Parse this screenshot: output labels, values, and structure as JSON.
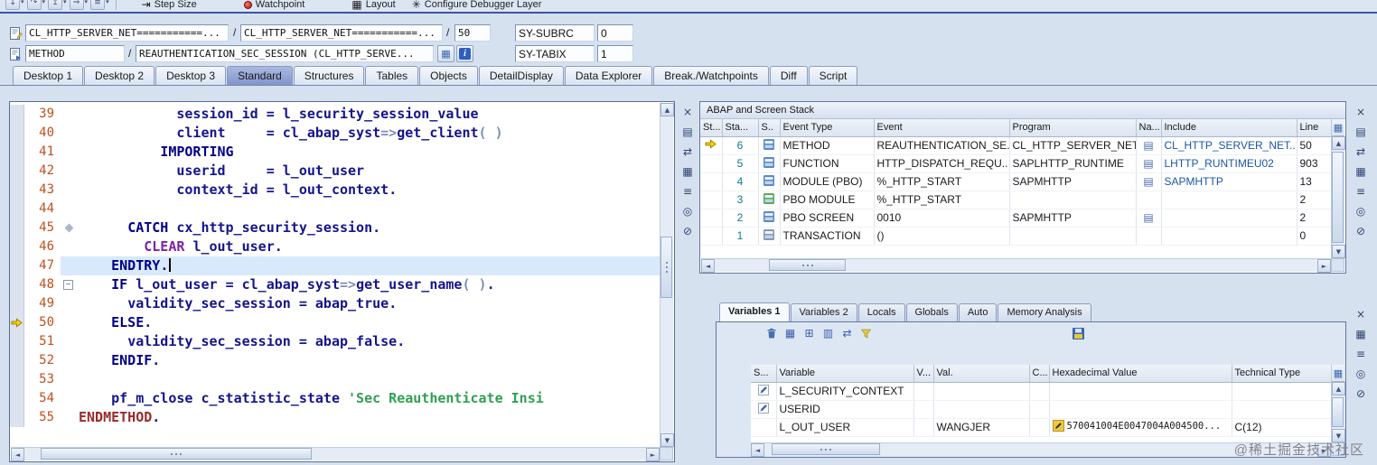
{
  "window": {
    "watermark": "@稀土掘金技术社区"
  },
  "toolbar": {
    "left_icons": [
      {
        "name": "step-into-icon"
      },
      {
        "name": "step-over-icon"
      },
      {
        "name": "step-return-icon"
      },
      {
        "name": "step-continue-icon"
      },
      {
        "name": "step-menu-icon"
      }
    ],
    "buttons": [
      {
        "name": "step-size-button",
        "icon": "step-size-icon",
        "label": "Step Size"
      },
      {
        "name": "watchpoint-button",
        "icon": "watchpoint-icon",
        "label": "Watchpoint"
      },
      {
        "name": "layout-button",
        "icon": "layout-icon",
        "label": "Layout"
      },
      {
        "name": "configure-debugger-layer-button",
        "icon": "configure-icon",
        "label": "Configure Debugger Layer"
      }
    ]
  },
  "header": {
    "slash": "/",
    "row1_icon": "source-page-icon",
    "row2_icon": "method-page-icon",
    "display_button_icon": "display-icon",
    "info_button_icon": "info-icon",
    "main_program": "CL_HTTP_SERVER_NET===========...",
    "source_code_of": "CL_HTTP_SERVER_NET===========...",
    "line_number": "50",
    "sy_subrc_label": "SY-SUBRC",
    "sy_subrc_value": "0",
    "event_type": "METHOD",
    "event_name": "REAUTHENTICATION_SEC_SESSION (CL_HTTP_SERVE...",
    "sy_tabix_label": "SY-TABIX",
    "sy_tabix_value": "1"
  },
  "desktop_tabs": {
    "active": "Standard",
    "items": [
      "Desktop 1",
      "Desktop 2",
      "Desktop 3",
      "Standard",
      "Structures",
      "Tables",
      "Objects",
      "DetailDisplay",
      "Data Explorer",
      "Break./Watchpoints",
      "Diff",
      "Script"
    ]
  },
  "editor": {
    "current_line": 47,
    "execution_line": 50,
    "lines": [
      {
        "n": 39,
        "t": [
          [
            "pl",
            "            "
          ],
          [
            "id",
            "session_id"
          ],
          [
            "pl",
            " "
          ],
          [
            "op",
            "="
          ],
          [
            "pl",
            " "
          ],
          [
            "id",
            "l_security_session_value"
          ]
        ]
      },
      {
        "n": 40,
        "t": [
          [
            "pl",
            "            "
          ],
          [
            "id",
            "client"
          ],
          [
            "pl",
            "     "
          ],
          [
            "op",
            "="
          ],
          [
            "pl",
            " "
          ],
          [
            "id",
            "cl_abap_syst"
          ],
          [
            "arr",
            "=>"
          ],
          [
            "id",
            "get_client"
          ],
          [
            "brk",
            "( )"
          ]
        ]
      },
      {
        "n": 41,
        "t": [
          [
            "pl",
            "          "
          ],
          [
            "kw",
            "IMPORTING"
          ]
        ]
      },
      {
        "n": 42,
        "t": [
          [
            "pl",
            "            "
          ],
          [
            "id",
            "userid"
          ],
          [
            "pl",
            "     "
          ],
          [
            "op",
            "="
          ],
          [
            "pl",
            " "
          ],
          [
            "id",
            "l_out_user"
          ]
        ]
      },
      {
        "n": 43,
        "t": [
          [
            "pl",
            "            "
          ],
          [
            "id",
            "context_id"
          ],
          [
            "pl",
            " "
          ],
          [
            "op",
            "="
          ],
          [
            "pl",
            " "
          ],
          [
            "id",
            "l_out_context"
          ],
          [
            "op",
            "."
          ]
        ]
      },
      {
        "n": 44,
        "t": []
      },
      {
        "n": 45,
        "fold": "diamond",
        "t": [
          [
            "pl",
            "      "
          ],
          [
            "kw",
            "CATCH"
          ],
          [
            "pl",
            " "
          ],
          [
            "id",
            "cx_http_security_session"
          ],
          [
            "op",
            "."
          ]
        ]
      },
      {
        "n": 46,
        "t": [
          [
            "pl",
            "        "
          ],
          [
            "kw2",
            "CLEAR"
          ],
          [
            "pl",
            " "
          ],
          [
            "id",
            "l_out_user"
          ],
          [
            "op",
            "."
          ]
        ]
      },
      {
        "n": 47,
        "caret": true,
        "t": [
          [
            "pl",
            "    "
          ],
          [
            "kw",
            "ENDTRY"
          ],
          [
            "op",
            "."
          ]
        ]
      },
      {
        "n": 48,
        "fold": "minus",
        "t": [
          [
            "pl",
            "    "
          ],
          [
            "kw",
            "IF"
          ],
          [
            "pl",
            " "
          ],
          [
            "id",
            "l_out_user"
          ],
          [
            "pl",
            " "
          ],
          [
            "op",
            "="
          ],
          [
            "pl",
            " "
          ],
          [
            "id",
            "cl_abap_syst"
          ],
          [
            "arr",
            "=>"
          ],
          [
            "id",
            "get_user_name"
          ],
          [
            "brk",
            "( )"
          ],
          [
            "op",
            "."
          ]
        ]
      },
      {
        "n": 49,
        "t": [
          [
            "pl",
            "      "
          ],
          [
            "id",
            "validity_sec_session"
          ],
          [
            "pl",
            " "
          ],
          [
            "op",
            "="
          ],
          [
            "pl",
            " "
          ],
          [
            "id",
            "abap_true"
          ],
          [
            "op",
            "."
          ]
        ]
      },
      {
        "n": 50,
        "t": [
          [
            "pl",
            "    "
          ],
          [
            "kw",
            "ELSE"
          ],
          [
            "op",
            "."
          ]
        ]
      },
      {
        "n": 51,
        "t": [
          [
            "pl",
            "      "
          ],
          [
            "id",
            "validity_sec_session"
          ],
          [
            "pl",
            " "
          ],
          [
            "op",
            "="
          ],
          [
            "pl",
            " "
          ],
          [
            "id",
            "abap_false"
          ],
          [
            "op",
            "."
          ]
        ]
      },
      {
        "n": 52,
        "t": [
          [
            "pl",
            "    "
          ],
          [
            "kw",
            "ENDIF"
          ],
          [
            "op",
            "."
          ]
        ]
      },
      {
        "n": 53,
        "t": []
      },
      {
        "n": 54,
        "t": [
          [
            "pl",
            "    "
          ],
          [
            "id",
            "pf_m_close"
          ],
          [
            "pl",
            " "
          ],
          [
            "id",
            "c_statistic_state"
          ],
          [
            "pl",
            " "
          ],
          [
            "str",
            "'Sec Reauthenticate Insi"
          ]
        ]
      },
      {
        "n": 55,
        "t": [
          [
            "kw3",
            "ENDMETHOD"
          ],
          [
            "op",
            "."
          ]
        ]
      }
    ]
  },
  "stack": {
    "title": "ABAP and Screen Stack",
    "columns": [
      "St...",
      "Sta...",
      "S..",
      "Event Type",
      "Event",
      "Program",
      "Na...",
      "Include",
      "Line"
    ],
    "rows": [
      {
        "active": true,
        "level": "6",
        "icon": "method-icon",
        "event_type": "METHOD",
        "event": "REAUTHENTICATION_SE..",
        "program": "CL_HTTP_SERVER_NET..",
        "nav": true,
        "include": "CL_HTTP_SERVER_NET..",
        "line": "50"
      },
      {
        "active": false,
        "level": "5",
        "icon": "function-icon",
        "event_type": "FUNCTION",
        "event": "HTTP_DISPATCH_REQU..",
        "program": "SAPLHTTP_RUNTIME",
        "nav": true,
        "include": "LHTTP_RUNTIMEU02",
        "line": "903"
      },
      {
        "active": false,
        "level": "4",
        "icon": "module-icon",
        "event_type": "MODULE (PBO)",
        "event": "%_HTTP_START",
        "program": "SAPMHTTP",
        "nav": true,
        "include": "SAPMHTTP",
        "line": "13"
      },
      {
        "active": false,
        "level": "3",
        "icon": "pbo-module-icon",
        "event_type": "PBO MODULE",
        "event": "%_HTTP_START",
        "program": "",
        "nav": false,
        "include": "",
        "line": "2"
      },
      {
        "active": false,
        "level": "2",
        "icon": "screen-icon",
        "event_type": "PBO SCREEN",
        "event": "0010",
        "program": "SAPMHTTP",
        "nav": true,
        "include": "",
        "line": "2"
      },
      {
        "active": false,
        "level": "1",
        "icon": "transaction-icon",
        "event_type": "TRANSACTION",
        "event": "()",
        "program": "",
        "nav": false,
        "include": "",
        "line": "0"
      }
    ]
  },
  "variables": {
    "tabs": [
      "Variables 1",
      "Variables 2",
      "Locals",
      "Globals",
      "Auto",
      "Memory Analysis"
    ],
    "active_tab": "Variables 1",
    "toolbar_icons": [
      {
        "name": "trash-icon"
      },
      {
        "name": "table-icon"
      },
      {
        "name": "table-plus-icon"
      },
      {
        "name": "table-columns-icon"
      },
      {
        "name": "swap-arrows-icon"
      },
      {
        "name": "funnel-icon"
      }
    ],
    "save_icon": "save-icon",
    "columns": [
      "S...",
      "Variable",
      "V...",
      "Val.",
      "C...",
      "Hexadecimal Value",
      "Technical Type"
    ],
    "rows": [
      {
        "icon": "pencil-icon",
        "variable": "L_SECURITY_CONTEXT",
        "v": "",
        "val": "",
        "c": "",
        "hex_icon": false,
        "hex": "",
        "type": ""
      },
      {
        "icon": "pencil-icon",
        "variable": "USERID",
        "v": "",
        "val": "",
        "c": "",
        "hex_icon": false,
        "hex": "",
        "type": ""
      },
      {
        "icon": "",
        "variable": "L_OUT_USER",
        "v": "",
        "val": "WANGJER",
        "c": "",
        "hex_icon": true,
        "hex": "570041004E0047004A004500...",
        "type": "C(12)"
      }
    ]
  },
  "side_icons": {
    "editor": [
      {
        "name": "close-icon"
      },
      {
        "name": "page-icon"
      },
      {
        "name": "swap-icon"
      },
      {
        "name": "grid-icon"
      },
      {
        "name": "list-icon"
      },
      {
        "name": "services-icon"
      },
      {
        "name": "filter-off-icon"
      }
    ],
    "stack": [
      {
        "name": "close-icon"
      },
      {
        "name": "page-icon"
      },
      {
        "name": "swap-icon"
      },
      {
        "name": "grid-icon"
      },
      {
        "name": "list-icon"
      },
      {
        "name": "services-icon"
      },
      {
        "name": "filter-off-icon"
      }
    ],
    "variables": [
      {
        "name": "close-icon"
      },
      {
        "name": "grid-icon"
      },
      {
        "name": "list-icon"
      },
      {
        "name": "services-icon"
      },
      {
        "name": "filter-off-icon"
      }
    ]
  },
  "colors": {
    "active_tab": "#8e9fd1",
    "execution_arrow": "#ffd700",
    "keyword": "#00008a",
    "identifier": "#14148c",
    "string_literal": "#2fa052",
    "line_number": "#c0511c",
    "stack_level": "#0e7a8c",
    "include_link": "#1a56a8"
  }
}
